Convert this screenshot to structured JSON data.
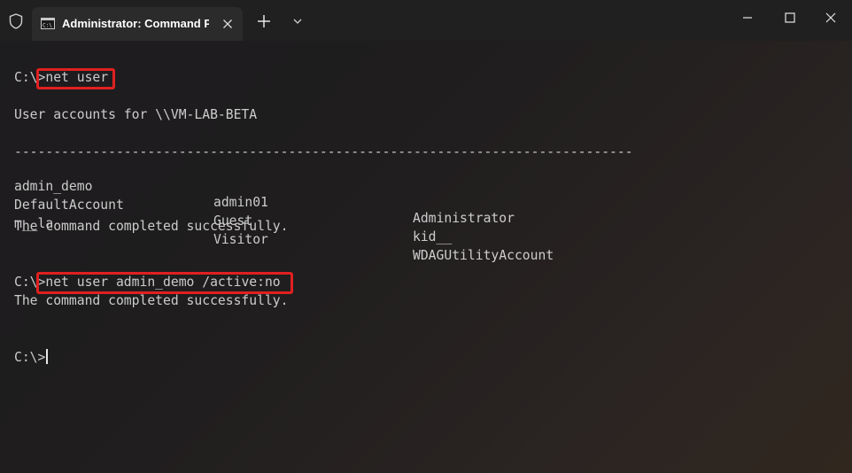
{
  "window": {
    "tab_title": "Administrator: Command Prompt",
    "icons": {
      "shield": "shield-icon",
      "tab": "command-prompt-icon",
      "close_tab": "close-icon",
      "new_tab": "plus-icon",
      "dropdown": "chevron-down-icon",
      "minimize": "minimize-icon",
      "maximize": "maximize-icon",
      "close": "close-icon"
    }
  },
  "terminal": {
    "prompt": "C:\\>",
    "command1": "net user",
    "accounts_header": "User accounts for \\\\VM-LAB-BETA",
    "separator": "-------------------------------------------------------------------------------",
    "accounts": [
      [
        "admin_demo",
        "admin01",
        "Administrator"
      ],
      [
        "DefaultAccount",
        "Guest",
        "kid__"
      ],
      [
        "m__la",
        "Visitor",
        "WDAGUtilityAccount"
      ]
    ],
    "success1": "The command completed successfully.",
    "command2": "net user admin_demo /active:no",
    "success2": "The command completed successfully.",
    "highlight_color": "#e02020"
  }
}
